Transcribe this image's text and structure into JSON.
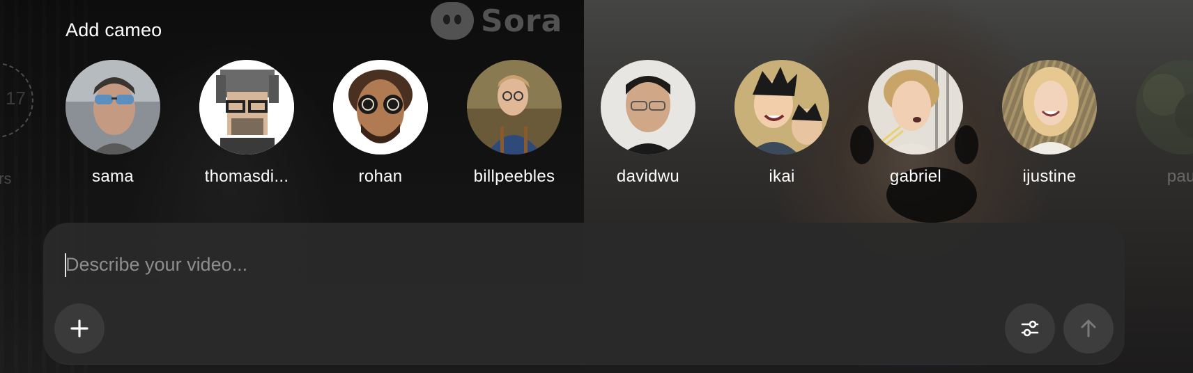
{
  "watermark": {
    "text": "Sora"
  },
  "background": {
    "clock_number": "17",
    "left_edge_text": "urs"
  },
  "cameo_section": {
    "title": "Add cameo",
    "cameos": [
      {
        "name": "sama"
      },
      {
        "name": "thomasdi..."
      },
      {
        "name": "rohan"
      },
      {
        "name": "billpeebles"
      },
      {
        "name": "davidwu"
      },
      {
        "name": "ikai"
      },
      {
        "name": "gabriel"
      },
      {
        "name": "ijustine"
      },
      {
        "name": "paul"
      }
    ]
  },
  "composer": {
    "input_value": "",
    "placeholder": "Describe your video...",
    "add_icon": "plus-icon",
    "settings_icon": "sliders-icon",
    "send_icon": "arrow-up-icon"
  },
  "colors": {
    "composer_bg": "#2a2a2a",
    "button_bg": "#3a3a3a",
    "placeholder": "#8e8e8e",
    "text": "#ffffff"
  }
}
